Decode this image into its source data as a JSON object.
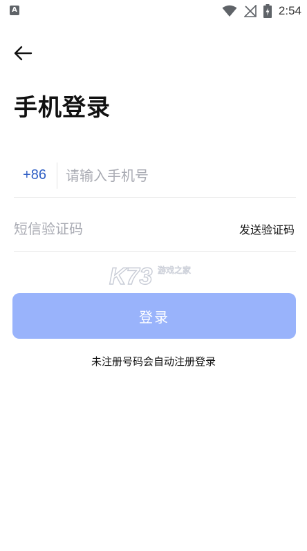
{
  "status_bar": {
    "time": "2:54",
    "app_icon_letter": "A",
    "icons": [
      "wifi-icon",
      "signal-off-icon",
      "battery-charging-icon"
    ]
  },
  "header": {
    "back_icon": "arrow-left-icon"
  },
  "title": "手机登录",
  "phone": {
    "country_code": "+86",
    "placeholder": "请输入手机号",
    "value": ""
  },
  "code": {
    "placeholder": "短信验证码",
    "value": "",
    "send_label": "发送验证码"
  },
  "watermark": {
    "brand": "K73",
    "tagline": "游戏之家"
  },
  "login_button": {
    "label": "登录",
    "color": "#99b3fb"
  },
  "hint": "未注册号码会自动注册登录",
  "colors": {
    "accent": "#2f5fc5",
    "button": "#99b3fb"
  }
}
